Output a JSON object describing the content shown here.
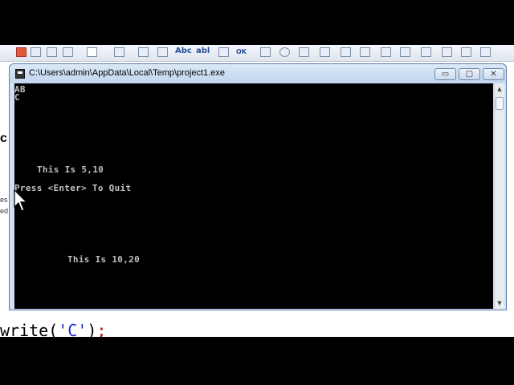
{
  "ide": {
    "toolbar_texts": [
      "Abc",
      "abl",
      "OK"
    ],
    "left_fragment_1": "c",
    "left_fragment_2_lines": [
      "es",
      "ed"
    ],
    "code_line": {
      "prefix": "write(",
      "string": "'C'",
      "suffix": ")",
      "semicolon": ";"
    }
  },
  "console": {
    "title": "C:\\Users\\admin\\AppData\\Local\\Temp\\project1.exe",
    "buttons": {
      "minimize": "▭",
      "maximize": "▢",
      "close": "✕"
    },
    "lines": [
      "AB",
      "C",
      "This Is 5,10",
      "Press <Enter> To Quit",
      "This Is 10,20"
    ],
    "scroll": {
      "up": "▲",
      "down": "▼"
    }
  },
  "colors": {
    "console_bg": "#000000",
    "console_text": "#c0c0c0",
    "titlebar": "#cfe0f3"
  }
}
